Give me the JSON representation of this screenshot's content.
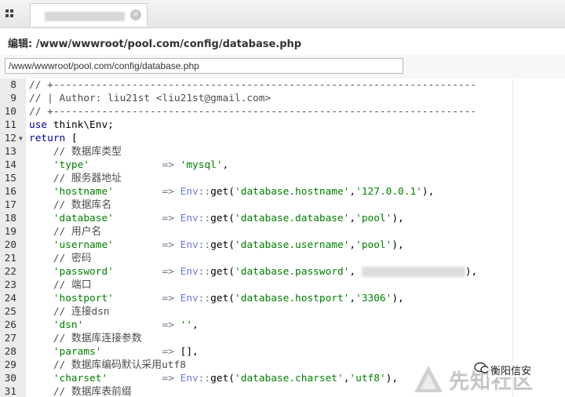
{
  "tab": {
    "close_icon": "×"
  },
  "title": {
    "label": "编辑: /www/wwwroot/pool.com/config/database.php"
  },
  "path_input": {
    "value": "/www/wwwroot/pool.com/config/database.php"
  },
  "editor": {
    "lines": [
      {
        "n": "8",
        "segments": [
          {
            "t": "// +----------------------------------------------------------------------",
            "c": "comment"
          }
        ]
      },
      {
        "n": "9",
        "segments": [
          {
            "t": "// | Author: liu21st <liu21st@gmail.com>",
            "c": "comment"
          }
        ]
      },
      {
        "n": "10",
        "segments": [
          {
            "t": "// +----------------------------------------------------------------------",
            "c": "comment"
          }
        ]
      },
      {
        "n": "11",
        "segments": [
          {
            "t": "use",
            "c": "kw"
          },
          {
            "t": " think\\Env;",
            "c": ""
          }
        ]
      },
      {
        "n": "12",
        "fold": true,
        "segments": [
          {
            "t": "return",
            "c": "kw"
          },
          {
            "t": " [",
            "c": ""
          }
        ]
      },
      {
        "n": "13",
        "segments": [
          {
            "t": "    // 数据库类型",
            "c": "comment"
          }
        ]
      },
      {
        "n": "14",
        "segments": [
          {
            "t": "    'type'",
            "c": "key"
          },
          {
            "t": "            => ",
            "c": "op"
          },
          {
            "t": "'mysql'",
            "c": "key"
          },
          {
            "t": ",",
            "c": ""
          }
        ]
      },
      {
        "n": "15",
        "segments": [
          {
            "t": "    // 服务器地址",
            "c": "comment"
          }
        ]
      },
      {
        "n": "16",
        "segments": [
          {
            "t": "    'hostname'",
            "c": "key"
          },
          {
            "t": "        => ",
            "c": "op"
          },
          {
            "t": "Env",
            "c": "cls"
          },
          {
            "t": "::",
            "c": "op"
          },
          {
            "t": "get(",
            "c": ""
          },
          {
            "t": "'database.hostname'",
            "c": "key"
          },
          {
            "t": ",",
            "c": ""
          },
          {
            "t": "'127.0.0.1'",
            "c": "key"
          },
          {
            "t": "),",
            "c": ""
          }
        ]
      },
      {
        "n": "17",
        "segments": [
          {
            "t": "    // 数据库名",
            "c": "comment"
          }
        ]
      },
      {
        "n": "18",
        "segments": [
          {
            "t": "    'database'",
            "c": "key"
          },
          {
            "t": "        => ",
            "c": "op"
          },
          {
            "t": "Env",
            "c": "cls"
          },
          {
            "t": "::",
            "c": "op"
          },
          {
            "t": "get(",
            "c": ""
          },
          {
            "t": "'database.database'",
            "c": "key"
          },
          {
            "t": ",",
            "c": ""
          },
          {
            "t": "'pool'",
            "c": "key"
          },
          {
            "t": "),",
            "c": ""
          }
        ]
      },
      {
        "n": "19",
        "segments": [
          {
            "t": "    // 用户名",
            "c": "comment"
          }
        ]
      },
      {
        "n": "20",
        "segments": [
          {
            "t": "    'username'",
            "c": "key"
          },
          {
            "t": "        => ",
            "c": "op"
          },
          {
            "t": "Env",
            "c": "cls"
          },
          {
            "t": "::",
            "c": "op"
          },
          {
            "t": "get(",
            "c": ""
          },
          {
            "t": "'database.username'",
            "c": "key"
          },
          {
            "t": ",",
            "c": ""
          },
          {
            "t": "'pool'",
            "c": "key"
          },
          {
            "t": "),",
            "c": ""
          }
        ]
      },
      {
        "n": "21",
        "segments": [
          {
            "t": "    // 密码",
            "c": "comment"
          }
        ]
      },
      {
        "n": "22",
        "segments": [
          {
            "t": "    'password'",
            "c": "key"
          },
          {
            "t": "        => ",
            "c": "op"
          },
          {
            "t": "Env",
            "c": "cls"
          },
          {
            "t": "::",
            "c": "op"
          },
          {
            "t": "get(",
            "c": ""
          },
          {
            "t": "'database.password'",
            "c": "key"
          },
          {
            "t": ", ",
            "c": ""
          },
          {
            "t": "",
            "c": "redact"
          },
          {
            "t": "),",
            "c": ""
          }
        ]
      },
      {
        "n": "23",
        "segments": [
          {
            "t": "    // 端口",
            "c": "comment"
          }
        ]
      },
      {
        "n": "24",
        "segments": [
          {
            "t": "    'hostport'",
            "c": "key"
          },
          {
            "t": "        => ",
            "c": "op"
          },
          {
            "t": "Env",
            "c": "cls"
          },
          {
            "t": "::",
            "c": "op"
          },
          {
            "t": "get(",
            "c": ""
          },
          {
            "t": "'database.hostport'",
            "c": "key"
          },
          {
            "t": ",",
            "c": ""
          },
          {
            "t": "'3306'",
            "c": "key"
          },
          {
            "t": "),",
            "c": ""
          }
        ]
      },
      {
        "n": "25",
        "segments": [
          {
            "t": "    // 连接dsn",
            "c": "comment"
          }
        ]
      },
      {
        "n": "26",
        "segments": [
          {
            "t": "    'dsn'",
            "c": "key"
          },
          {
            "t": "             => ",
            "c": "op"
          },
          {
            "t": "''",
            "c": "key"
          },
          {
            "t": ",",
            "c": ""
          }
        ]
      },
      {
        "n": "27",
        "segments": [
          {
            "t": "    // 数据库连接参数",
            "c": "comment"
          }
        ]
      },
      {
        "n": "28",
        "segments": [
          {
            "t": "    'params'",
            "c": "key"
          },
          {
            "t": "          => ",
            "c": "op"
          },
          {
            "t": "[],",
            "c": ""
          }
        ]
      },
      {
        "n": "29",
        "segments": [
          {
            "t": "    // 数据库编码默认采用utf8",
            "c": "comment"
          }
        ]
      },
      {
        "n": "30",
        "segments": [
          {
            "t": "    'charset'",
            "c": "key"
          },
          {
            "t": "         => ",
            "c": "op"
          },
          {
            "t": "Env",
            "c": "cls"
          },
          {
            "t": "::",
            "c": "op"
          },
          {
            "t": "get(",
            "c": ""
          },
          {
            "t": "'database.charset'",
            "c": "key"
          },
          {
            "t": ",",
            "c": ""
          },
          {
            "t": "'utf8'",
            "c": "key"
          },
          {
            "t": "),",
            "c": ""
          }
        ]
      },
      {
        "n": "31",
        "segments": [
          {
            "t": "    // 数据库表前缀",
            "c": "comment"
          }
        ]
      }
    ]
  },
  "watermark": {
    "text": "先知社区",
    "badge": "衡阳信安"
  }
}
